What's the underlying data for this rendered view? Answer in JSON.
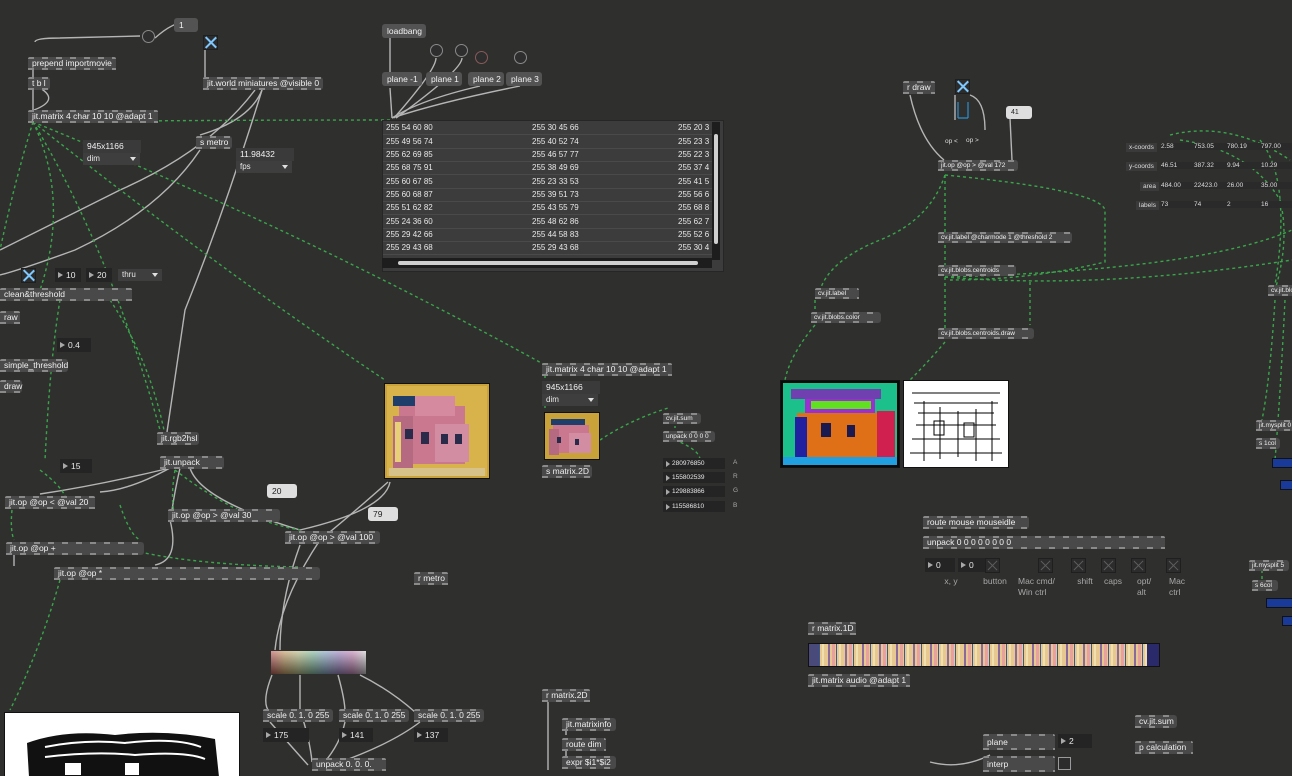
{
  "top_messages": {
    "one": "1",
    "loadbang": "loadbang",
    "plane_m1": "plane -1",
    "plane1": "plane 1",
    "plane2": "plane 2",
    "plane3": "plane 3"
  },
  "left_chain": {
    "prepend": "prepend importmovie",
    "tbl": "t b l",
    "matrix_main": "jit.matrix 4 char 10 10 @adapt 1",
    "world": "jit.world miniatures @visible 0",
    "s_metro": "s metro",
    "fps_value": "11.98432",
    "fps_label": "fps",
    "dim_value": "945x1166",
    "dim_label": "dim",
    "num10": "10",
    "num20": "20",
    "thru": "thru",
    "clean": "clean&threshold",
    "raw": "raw",
    "num04": "0.4",
    "simple": "simple_threshold",
    "draw": "draw",
    "rgb2hsl": "jit.rgb2hsl",
    "unpack": "jit.unpack",
    "num15": "15",
    "op_lt": "jit.op @op < @val 20",
    "num20b": "20",
    "op_gt30": "jit.op @op > @val 30",
    "num79": "79",
    "op_gt100": "jit.op @op > @val 100",
    "op_plus": "jit.op @op +",
    "op_mul": "jit.op @op *",
    "r_metro": "r metro"
  },
  "table_rows": [
    [
      "255 54 60 80",
      "255 30 45 66",
      "255 20 3"
    ],
    [
      "255 49 56 74",
      "255 40 52 74",
      "255 23 3"
    ],
    [
      "255 62 69 85",
      "255 46 57 77",
      "255 22 3"
    ],
    [
      "255 68 75 91",
      "255 38 49 69",
      "255 37 4"
    ],
    [
      "255 60 67 85",
      "255 23 33 53",
      "255 41 5"
    ],
    [
      "255 60 68 87",
      "255 39 51 73",
      "255 56 6"
    ],
    [
      "255 51 62 82",
      "255 43 55 79",
      "255 68 8"
    ],
    [
      "255 24 36 60",
      "255 48 62 86",
      "255 62 7"
    ],
    [
      "255 29 42 66",
      "255 44 58 83",
      "255 52 6"
    ],
    [
      "255 29 43 68",
      "255 29 43 68",
      "255 30 4"
    ]
  ],
  "mid_chain": {
    "matrix2": "jit.matrix 4 char 10 10 @adapt 1",
    "dim_value": "945x1166",
    "dim_label": "dim",
    "s_matrix2d": "s matrix.2D",
    "sum": "cv.jit.sum",
    "unpack4": "unpack 0 0 0 0",
    "sums": [
      {
        "value": "280976850",
        "channel": "A"
      },
      {
        "value": "155802539",
        "channel": "R"
      },
      {
        "value": "129883866",
        "channel": "G"
      },
      {
        "value": "115586810",
        "channel": "B"
      }
    ],
    "r_matrix2d": "r matrix.2D",
    "matrixinfo": "jit.matrixinfo",
    "route_dim": "route dim",
    "expr": "expr $i1*$i2"
  },
  "scales": {
    "s1": "scale 0. 1. 0 255",
    "s2": "scale 0. 1. 0 255",
    "s3": "scale 0. 1. 0 255",
    "v1": "175",
    "v2": "141",
    "v3": "137",
    "unpack": "unpack 0. 0. 0."
  },
  "cv_chain": {
    "r_draw": "r draw",
    "op_lt": "op <",
    "op_gt": "op >",
    "num41": "41",
    "jitop": "jit.op @op > @val 172",
    "label_box": "cv.jit.label @charmode 1 @threshold 2",
    "centroids": "cv.jit.blobs.centroids",
    "centroids_draw": "cv.jit.blobs.centroids.draw",
    "label": "cv.jit.label",
    "color": "cv.jit.blobs.color"
  },
  "coords": {
    "x_label": "x-coords",
    "y_label": "y-coords",
    "area_label": "area",
    "labels_label": "labels",
    "x": [
      "2.58",
      "753.05",
      "780.19",
      "797.00"
    ],
    "y": [
      "46.51",
      "387.32",
      "9.94",
      "10.29"
    ],
    "area": [
      "484.00",
      "22423.0",
      "26.00",
      "35.00"
    ],
    "labels": [
      "73",
      "74",
      "2",
      "16"
    ]
  },
  "mouse": {
    "route": "route mouse mouseidle",
    "unpack": "unpack 0 0 0 0 0 0 0 0",
    "n1": "0",
    "n2": "0",
    "c_xy": "x, y",
    "c_button": "button",
    "c_mac1": "Mac cmd/",
    "c_mac2": "Win ctrl",
    "c_shift": "shift",
    "c_caps": "caps",
    "c_opt1": "opt/",
    "c_opt2": "alt",
    "c_macc1": "Mac",
    "c_macc2": "ctrl"
  },
  "audio": {
    "r": "r matrix.1D",
    "matrix": "jit.matrix audio @adapt 1"
  },
  "bottom_right": {
    "plane": "plane",
    "plane_val": "2",
    "interp": "interp",
    "sum": "cv.jit.sum",
    "p_calc": "p calculation"
  },
  "far_right": {
    "blob": "cv.jit.blo",
    "mysplit0": "jit.mysplit 0",
    "s1col": "s 1col",
    "mysplit5": "jit.mysplit 5",
    "s6col": "s 6col"
  }
}
